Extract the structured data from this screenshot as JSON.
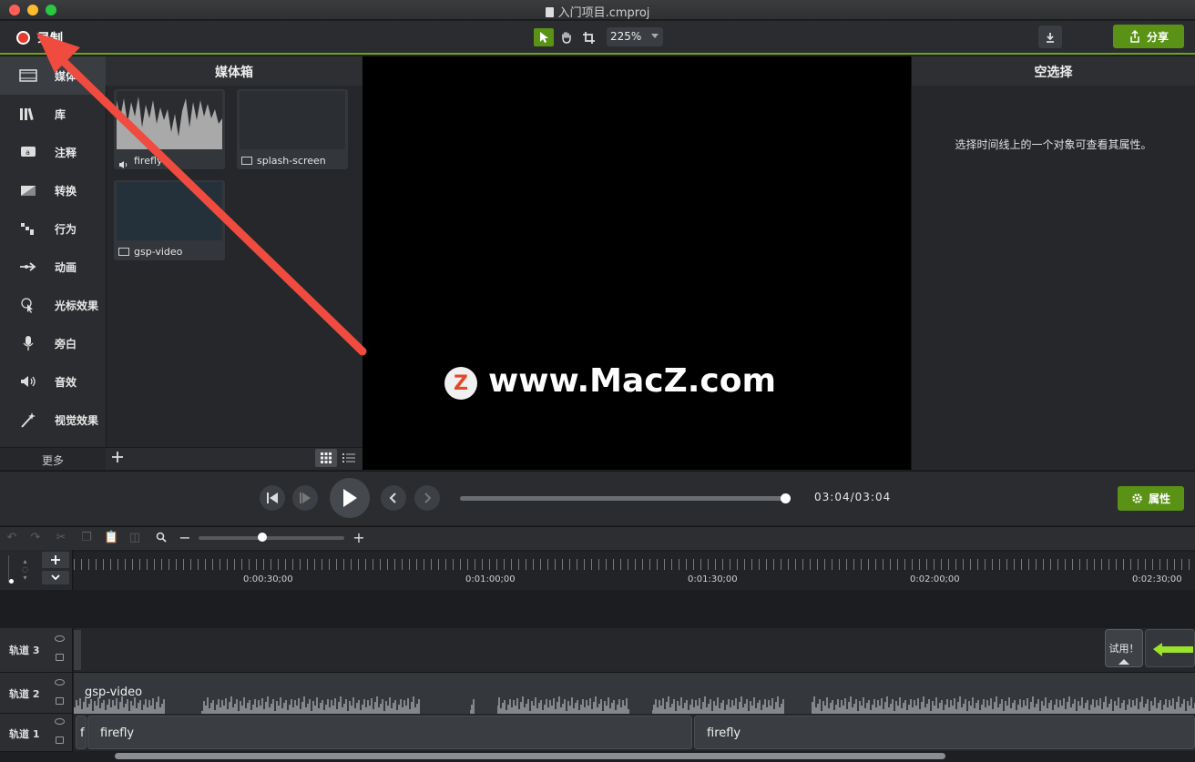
{
  "window": {
    "title": "入门项目.cmproj"
  },
  "toolbar": {
    "record_label": "录制",
    "zoom_value": "225%",
    "share_label": "分享"
  },
  "sidebar": {
    "items": [
      {
        "label": "媒体",
        "icon": "film-icon"
      },
      {
        "label": "库",
        "icon": "library-icon"
      },
      {
        "label": "注释",
        "icon": "annotation-icon"
      },
      {
        "label": "转换",
        "icon": "transition-icon"
      },
      {
        "label": "行为",
        "icon": "behavior-icon"
      },
      {
        "label": "动画",
        "icon": "animation-icon"
      },
      {
        "label": "光标效果",
        "icon": "cursor-effect-icon"
      },
      {
        "label": "旁白",
        "icon": "microphone-icon"
      },
      {
        "label": "音效",
        "icon": "speaker-icon"
      },
      {
        "label": "视觉效果",
        "icon": "magic-wand-icon"
      }
    ],
    "more_label": "更多"
  },
  "media_bin": {
    "title": "媒体箱",
    "items": [
      {
        "name": "firefly",
        "kind": "audio"
      },
      {
        "name": "splash-screen",
        "kind": "video"
      },
      {
        "name": "gsp-video",
        "kind": "video"
      }
    ]
  },
  "canvas": {
    "watermark": "www.MacZ.com",
    "watermark_logo": "Z"
  },
  "properties": {
    "title": "空选择",
    "message": "选择时间线上的一个对象可查看其属性。",
    "button_label": "属性"
  },
  "playback": {
    "timecode": "03:04/03:04",
    "progress": 1.0
  },
  "timeline": {
    "ruler_labels": [
      "0:00:30;00",
      "0:01:00;00",
      "0:01:30;00",
      "0:02:00;00",
      "0:02:30;00"
    ],
    "tracks": [
      {
        "name": "轨道 3",
        "clips": []
      },
      {
        "name": "轨道 2",
        "clips": [
          "gsp-video"
        ]
      },
      {
        "name": "轨道 1",
        "clips": [
          "f",
          "firefly",
          "firefly"
        ]
      }
    ],
    "trial_label": "试用！"
  },
  "colors": {
    "accent_green": "#5a9216",
    "record_red": "#e53a2f",
    "arrow_red": "#ef4b3f",
    "highlight_green": "#9be22b"
  }
}
